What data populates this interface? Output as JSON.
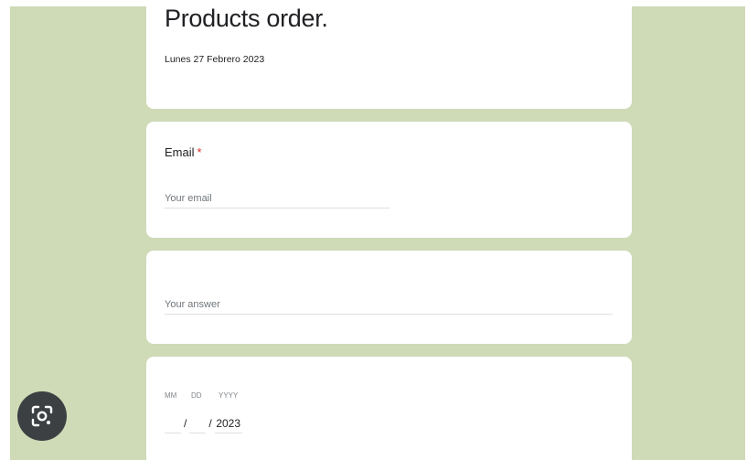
{
  "form": {
    "title": "Products order.",
    "subtitle": "Lunes 27 Febrero 2023"
  },
  "email_question": {
    "label": "Email",
    "required_mark": "*",
    "placeholder": "Your email"
  },
  "answer_question": {
    "placeholder": "Your answer"
  },
  "date_question": {
    "month_label": "MM",
    "day_label": "DD",
    "year_label": "YYYY",
    "separator": "/",
    "month_value": "",
    "day_value": "",
    "year_value": "2023"
  },
  "overlay": {
    "lens_icon": "visual-search-icon"
  },
  "colors": {
    "background": "#cfdab7",
    "card": "#ffffff",
    "required": "#d93025",
    "lens_button": "#3c4043"
  }
}
